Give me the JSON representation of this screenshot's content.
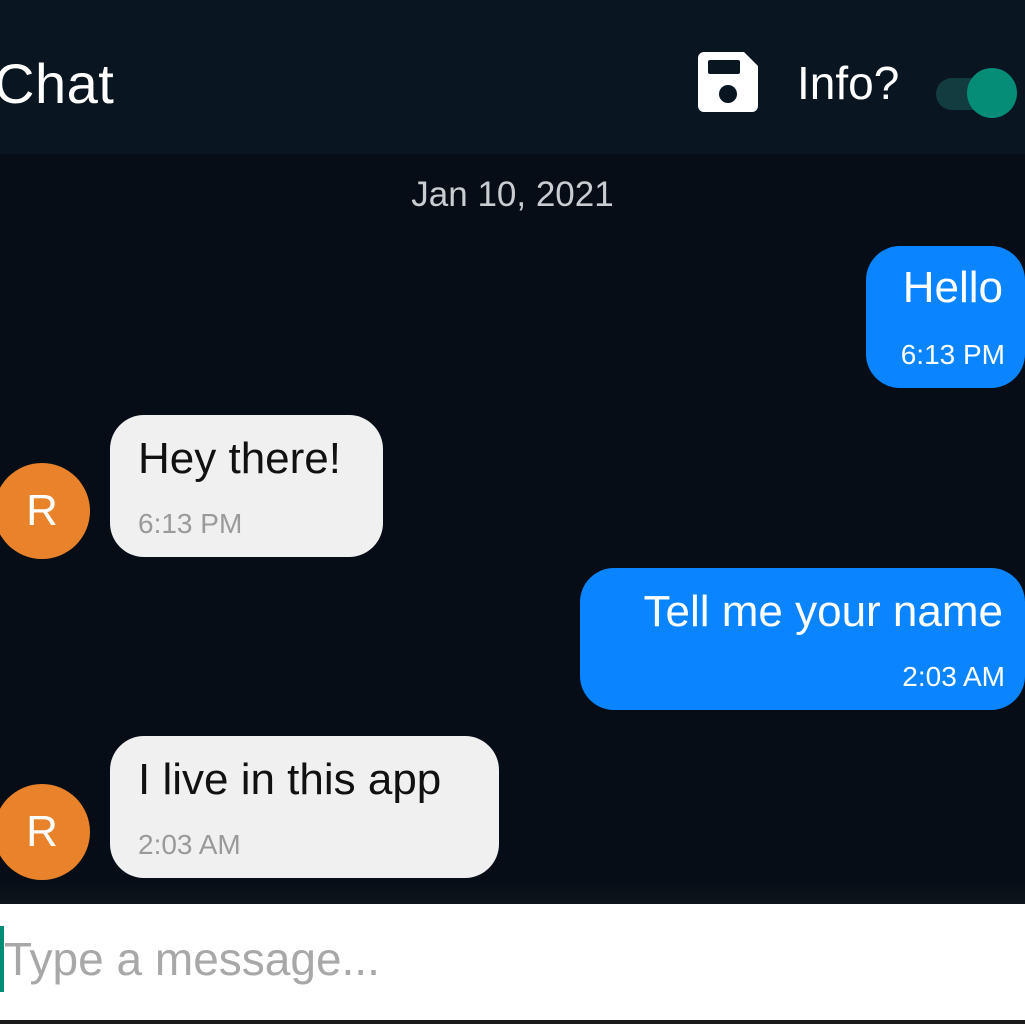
{
  "header": {
    "title": "Chat",
    "save_icon": "save-icon",
    "info_label": "Info?",
    "info_toggle_on": true
  },
  "chat": {
    "date": "Jan 10, 2021",
    "messages": [
      {
        "direction": "outgoing",
        "text": "Hello",
        "time": "6:13 PM"
      },
      {
        "direction": "incoming",
        "avatar": "R",
        "text": "Hey there!",
        "time": "6:13 PM"
      },
      {
        "direction": "outgoing",
        "text": "Tell me your name",
        "time": "2:03 AM"
      },
      {
        "direction": "incoming",
        "avatar": "R",
        "text": "I live in this app",
        "time": "2:03 AM"
      }
    ]
  },
  "composer": {
    "placeholder": "Type a message...",
    "value": ""
  },
  "colors": {
    "outgoing_bubble": "#0a84ff",
    "incoming_bubble": "#f0f0f0",
    "avatar": "#e8832b",
    "toggle_accent": "#058d77",
    "background": "#060d16",
    "header_background": "#091520"
  }
}
